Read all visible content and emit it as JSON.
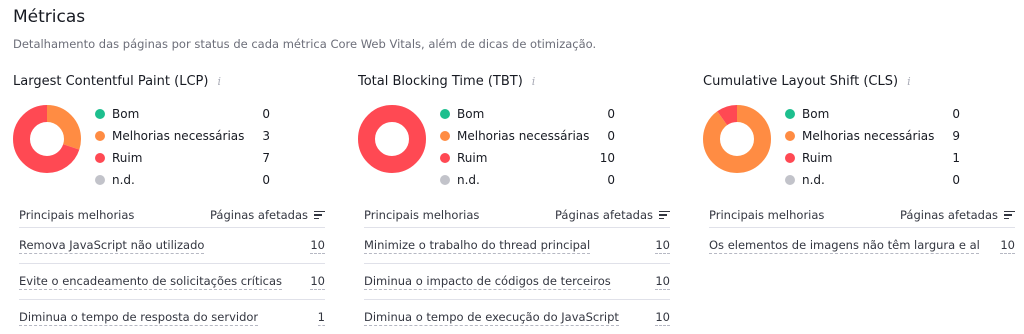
{
  "header": {
    "title": "Métricas",
    "subtitle": "Detalhamento das páginas por status de cada métrica Core Web Vitals, além de dicas de otimização."
  },
  "colors": {
    "good": "#1dbf8e",
    "needs_improvement": "#ff8c43",
    "poor": "#ff4953",
    "na": "#c2c3ca"
  },
  "legend_labels": {
    "good": "Bom",
    "needs_improvement": "Melhorias necessárias",
    "poor": "Ruim",
    "na": "n.d."
  },
  "table_headers": {
    "improvements": "Principais melhorias",
    "pages": "Páginas afetadas"
  },
  "panels": [
    {
      "title": "Largest Contentful Paint (LCP)",
      "values": {
        "good": "0",
        "needs_improvement": "3",
        "poor": "7",
        "na": "0"
      },
      "rows": [
        {
          "label": "Remova JavaScript não utilizado",
          "count": "10"
        },
        {
          "label": "Evite o encadeamento de solicitações críticas",
          "count": "10"
        },
        {
          "label": "Diminua o tempo de resposta do servidor",
          "count": "1"
        }
      ]
    },
    {
      "title": "Total Blocking Time (TBT)",
      "values": {
        "good": "0",
        "needs_improvement": "0",
        "poor": "10",
        "na": "0"
      },
      "rows": [
        {
          "label": "Minimize o trabalho do thread principal",
          "count": "10"
        },
        {
          "label": "Diminua o impacto de códigos de terceiros",
          "count": "10"
        },
        {
          "label": "Diminua o tempo de execução do JavaScript",
          "count": "10"
        }
      ]
    },
    {
      "title": "Cumulative Layout Shift (CLS)",
      "values": {
        "good": "0",
        "needs_improvement": "9",
        "poor": "1",
        "na": "0"
      },
      "rows": [
        {
          "label": "Os elementos de imagens não têm largura e al...",
          "count": "10"
        }
      ]
    }
  ]
}
